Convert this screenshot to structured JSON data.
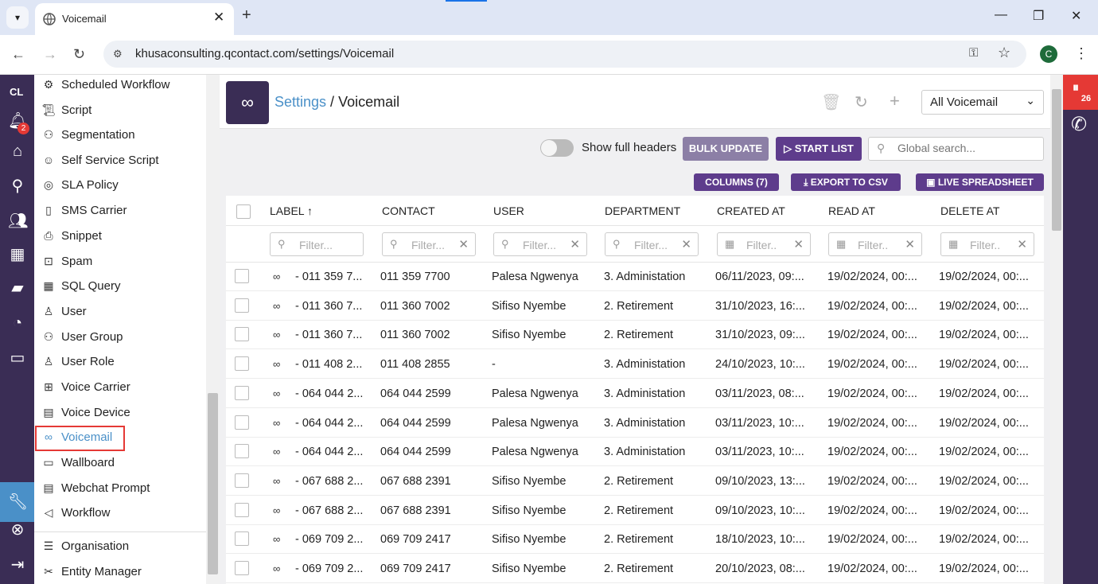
{
  "browser": {
    "tab_title": "Voicemail",
    "url": "khusaconsulting.qcontact.com/settings/Voicemail",
    "profile_initial": "C"
  },
  "left_rail": {
    "org_initials": "CL",
    "notification_count": "2"
  },
  "sidebar": {
    "items": [
      {
        "label": "Scheduled Workflow",
        "icon": "workflow-icon"
      },
      {
        "label": "Script",
        "icon": "script-icon"
      },
      {
        "label": "Segmentation",
        "icon": "segmentation-icon"
      },
      {
        "label": "Self Service Script",
        "icon": "robot-icon"
      },
      {
        "label": "SLA Policy",
        "icon": "policy-icon"
      },
      {
        "label": "SMS Carrier",
        "icon": "phone-icon"
      },
      {
        "label": "Snippet",
        "icon": "snippet-icon"
      },
      {
        "label": "Spam",
        "icon": "spam-icon"
      },
      {
        "label": "SQL Query",
        "icon": "table-icon"
      },
      {
        "label": "User",
        "icon": "user-icon"
      },
      {
        "label": "User Group",
        "icon": "user-group-icon"
      },
      {
        "label": "User Role",
        "icon": "user-role-icon"
      },
      {
        "label": "Voice Carrier",
        "icon": "network-icon"
      },
      {
        "label": "Voice Device",
        "icon": "device-icon"
      },
      {
        "label": "Voicemail",
        "icon": "voicemail-icon",
        "active": true
      },
      {
        "label": "Wallboard",
        "icon": "monitor-icon"
      },
      {
        "label": "Webchat Prompt",
        "icon": "chat-icon"
      },
      {
        "label": "Workflow",
        "icon": "send-icon"
      }
    ],
    "footer_items": [
      {
        "label": "Organisation",
        "icon": "sliders-icon"
      },
      {
        "label": "Entity Manager",
        "icon": "tools-icon"
      }
    ]
  },
  "header": {
    "breadcrumb_link": "Settings",
    "breadcrumb_sep": " / ",
    "breadcrumb_current": "Voicemail",
    "view_select": "All Voicemail"
  },
  "toolbar": {
    "toggle_label": "Show full headers",
    "bulk_update": "BULK UPDATE",
    "start_list": "START LIST",
    "global_search_placeholder": "Global search...",
    "columns": "COLUMNS (7)",
    "export_csv": "EXPORT TO CSV",
    "live_spreadsheet": "LIVE SPREADSHEET"
  },
  "table": {
    "columns": [
      "LABEL",
      "CONTACT",
      "USER",
      "DEPARTMENT",
      "CREATED AT",
      "READ AT",
      "DELETE AT"
    ],
    "sort_indicator": "↑",
    "filter_placeholder": "Filter...",
    "date_filter_placeholder": "Filter..",
    "rows": [
      {
        "label": "- 011 359 7...",
        "contact": "011 359 7700",
        "user": "Palesa Ngwenya",
        "department": "3. Administation",
        "created": "06/11/2023, 09:...",
        "read": "19/02/2024, 00:...",
        "delete": "19/02/2024, 00:..."
      },
      {
        "label": "- 011 360 7...",
        "contact": "011 360 7002",
        "user": "Sifiso Nyembe",
        "department": "2. Retirement",
        "created": "31/10/2023, 16:...",
        "read": "19/02/2024, 00:...",
        "delete": "19/02/2024, 00:..."
      },
      {
        "label": "- 011 360 7...",
        "contact": "011 360 7002",
        "user": "Sifiso Nyembe",
        "department": "2. Retirement",
        "created": "31/10/2023, 09:...",
        "read": "19/02/2024, 00:...",
        "delete": "19/02/2024, 00:..."
      },
      {
        "label": "- 011 408 2...",
        "contact": "011 408 2855",
        "user": "-",
        "department": "3. Administation",
        "created": "24/10/2023, 10:...",
        "read": "19/02/2024, 00:...",
        "delete": "19/02/2024, 00:..."
      },
      {
        "label": "- 064 044 2...",
        "contact": "064 044 2599",
        "user": "Palesa Ngwenya",
        "department": "3. Administation",
        "created": "03/11/2023, 08:...",
        "read": "19/02/2024, 00:...",
        "delete": "19/02/2024, 00:..."
      },
      {
        "label": "- 064 044 2...",
        "contact": "064 044 2599",
        "user": "Palesa Ngwenya",
        "department": "3. Administation",
        "created": "03/11/2023, 10:...",
        "read": "19/02/2024, 00:...",
        "delete": "19/02/2024, 00:..."
      },
      {
        "label": "- 064 044 2...",
        "contact": "064 044 2599",
        "user": "Palesa Ngwenya",
        "department": "3. Administation",
        "created": "03/11/2023, 10:...",
        "read": "19/02/2024, 00:...",
        "delete": "19/02/2024, 00:..."
      },
      {
        "label": "- 067 688 2...",
        "contact": "067 688 2391",
        "user": "Sifiso Nyembe",
        "department": "2. Retirement",
        "created": "09/10/2023, 13:...",
        "read": "19/02/2024, 00:...",
        "delete": "19/02/2024, 00:..."
      },
      {
        "label": "- 067 688 2...",
        "contact": "067 688 2391",
        "user": "Sifiso Nyembe",
        "department": "2. Retirement",
        "created": "09/10/2023, 10:...",
        "read": "19/02/2024, 00:...",
        "delete": "19/02/2024, 00:..."
      },
      {
        "label": "- 069 709 2...",
        "contact": "069 709 2417",
        "user": "Sifiso Nyembe",
        "department": "2. Retirement",
        "created": "18/10/2023, 10:...",
        "read": "19/02/2024, 00:...",
        "delete": "19/02/2024, 00:..."
      },
      {
        "label": "- 069 709 2...",
        "contact": "069 709 2417",
        "user": "Sifiso Nyembe",
        "department": "2. Retirement",
        "created": "20/10/2023, 08:...",
        "read": "19/02/2024, 00:...",
        "delete": "19/02/2024, 00:..."
      }
    ]
  },
  "right_rail": {
    "queue_count": "26"
  },
  "colors": {
    "brand_dark": "#3a2d55",
    "button_purple": "#5e3c8c",
    "link_blue": "#4a90c8",
    "alert_red": "#e53935"
  }
}
